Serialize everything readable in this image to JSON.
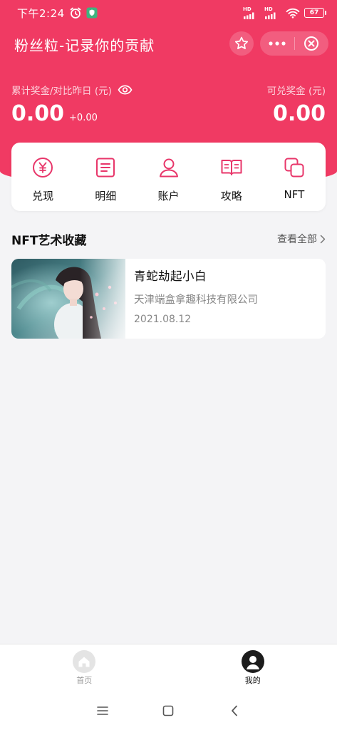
{
  "status_bar": {
    "time": "下午2:24",
    "battery": "67",
    "signal_labels": [
      "HD",
      "HD"
    ]
  },
  "nav": {
    "title": "粉丝粒-记录你的贡献",
    "star_icon": "star-icon",
    "more_icon": "more-dots-icon",
    "close_icon": "close-circle-icon"
  },
  "balance": {
    "left_label": "累计奖金/对比昨日 (元)",
    "left_value": "0.00",
    "left_change": "+0.00",
    "right_label": "可兑奖金 (元)",
    "right_value": "0.00",
    "eye_icon": "eye-icon"
  },
  "actions": [
    {
      "label": "兑现",
      "icon": "yuan-circle-icon"
    },
    {
      "label": "明细",
      "icon": "document-list-icon"
    },
    {
      "label": "账户",
      "icon": "user-icon"
    },
    {
      "label": "攻略",
      "icon": "open-book-icon"
    },
    {
      "label": "NFT",
      "icon": "nft-layers-icon"
    }
  ],
  "section": {
    "title": "NFT艺术收藏",
    "view_all": "查看全部"
  },
  "nft_items": [
    {
      "name": "青蛇劫起小白",
      "issuer": "天津端盒拿趣科技有限公司",
      "date": "2021.08.12"
    }
  ],
  "tabbar": {
    "home": "首页",
    "me": "我的"
  },
  "colors": {
    "brand": "#f03a63",
    "accent_icon": "#e8366a"
  }
}
